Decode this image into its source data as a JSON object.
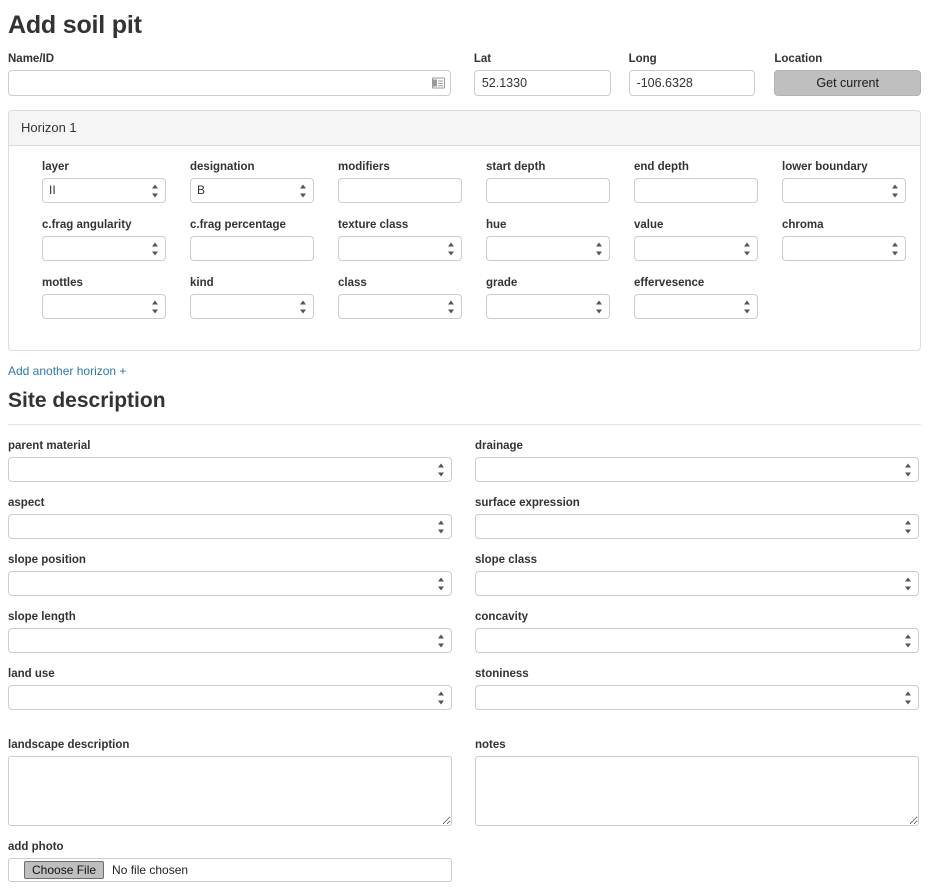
{
  "page": {
    "title": "Add soil pit",
    "link_color": "#2a7ab0",
    "button_color": "#bfbfbf",
    "panel_header_bg": "#f5f5f5"
  },
  "top": {
    "name": {
      "label": "Name/ID",
      "value": "",
      "placeholder": "",
      "icon": "contact-card-icon"
    },
    "lat": {
      "label": "Lat",
      "value": "52.1330"
    },
    "long": {
      "label": "Long",
      "value": "-106.6328"
    },
    "location": {
      "label": "Location",
      "button_label": "Get current"
    }
  },
  "horizon": {
    "header": "Horizon 1",
    "add_link": "Add another horizon +",
    "fields": [
      {
        "label": "layer",
        "type": "select",
        "value": "II"
      },
      {
        "label": "designation",
        "type": "select",
        "value": "B"
      },
      {
        "label": "modifiers",
        "type": "text",
        "value": ""
      },
      {
        "label": "start depth",
        "type": "text",
        "value": ""
      },
      {
        "label": "end depth",
        "type": "text",
        "value": ""
      },
      {
        "label": "lower boundary",
        "type": "select",
        "value": ""
      },
      {
        "label": "c.frag angularity",
        "type": "select",
        "value": ""
      },
      {
        "label": "c.frag percentage",
        "type": "text",
        "value": ""
      },
      {
        "label": "texture class",
        "type": "select",
        "value": ""
      },
      {
        "label": "hue",
        "type": "select",
        "value": ""
      },
      {
        "label": "value",
        "type": "select",
        "value": ""
      },
      {
        "label": "chroma",
        "type": "select",
        "value": ""
      },
      {
        "label": "mottles",
        "type": "select",
        "value": ""
      },
      {
        "label": "kind",
        "type": "select",
        "value": ""
      },
      {
        "label": "class",
        "type": "select",
        "value": ""
      },
      {
        "label": "grade",
        "type": "select",
        "value": ""
      },
      {
        "label": "effervesence",
        "type": "select",
        "value": ""
      }
    ]
  },
  "site": {
    "title": "Site description",
    "left": [
      {
        "label": "parent material",
        "type": "select",
        "value": ""
      },
      {
        "label": "aspect",
        "type": "select",
        "value": ""
      },
      {
        "label": "slope position",
        "type": "select",
        "value": ""
      },
      {
        "label": "slope length",
        "type": "select",
        "value": ""
      },
      {
        "label": "land use",
        "type": "select",
        "value": ""
      }
    ],
    "right": [
      {
        "label": "drainage",
        "type": "select",
        "value": ""
      },
      {
        "label": "surface expression",
        "type": "select",
        "value": ""
      },
      {
        "label": "slope class",
        "type": "select",
        "value": ""
      },
      {
        "label": "concavity",
        "type": "select",
        "value": ""
      },
      {
        "label": "stoniness",
        "type": "select",
        "value": ""
      }
    ],
    "landscape_description": {
      "label": "landscape description",
      "value": "",
      "placeholder": ""
    },
    "notes": {
      "label": "notes",
      "value": "",
      "placeholder": ""
    },
    "add_photo": {
      "label": "add photo",
      "button_label": "Choose File",
      "status": "No file chosen"
    }
  }
}
